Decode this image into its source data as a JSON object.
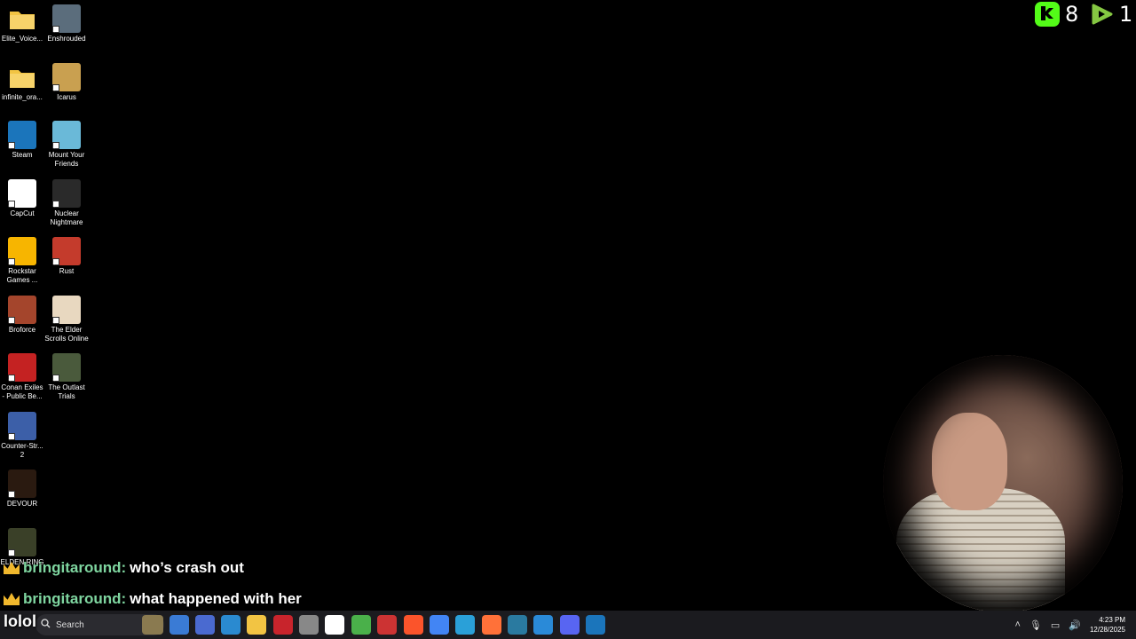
{
  "desktop": {
    "icons": [
      {
        "label": "Elite_Voice...",
        "icon": "folder-icon",
        "color": "#f2c443"
      },
      {
        "label": "Enshrouded",
        "icon": "enshrouded-game-icon",
        "color": "#5b6d7c"
      },
      {
        "label": "infinite_ora...",
        "icon": "folder-icon",
        "color": "#f2c443"
      },
      {
        "label": "Icarus",
        "icon": "icarus-game-icon",
        "color": "#c9a050"
      },
      {
        "label": "Steam",
        "icon": "steam-icon",
        "color": "#1b75bb"
      },
      {
        "label": "Mount Your Friends",
        "icon": "mount-your-friends-icon",
        "color": "#6ab9d8"
      },
      {
        "label": "CapCut",
        "icon": "capcut-icon",
        "color": "#ffffff"
      },
      {
        "label": "Nuclear Nightmare",
        "icon": "nuclear-nightmare-icon",
        "color": "#2a2a2a"
      },
      {
        "label": "Rockstar Games ...",
        "icon": "rockstar-games-icon",
        "color": "#f7b500"
      },
      {
        "label": "Rust",
        "icon": "rust-game-icon",
        "color": "#c43b2c"
      },
      {
        "label": "Broforce",
        "icon": "broforce-icon",
        "color": "#a4452c"
      },
      {
        "label": "The Elder Scrolls Online",
        "icon": "elder-scrolls-online-icon",
        "color": "#e8d8c0"
      },
      {
        "label": "Conan Exiles - Public Be...",
        "icon": "conan-exiles-icon",
        "color": "#c42222"
      },
      {
        "label": "The Outlast Trials",
        "icon": "outlast-trials-icon",
        "color": "#4a5a3c"
      },
      {
        "label": "Counter-Str... 2",
        "icon": "counter-strike-icon",
        "color": "#3c5fa8"
      },
      {
        "label": "DEVOUR",
        "icon": "devour-icon",
        "color": "#2a1a10"
      },
      {
        "label": "ELDEN RING",
        "icon": "elden-ring-icon",
        "color": "#3a4028"
      }
    ]
  },
  "counters": {
    "kick": {
      "value": "8",
      "color": "#53fc18",
      "icon": "kick-icon"
    },
    "rumble": {
      "value": "1",
      "color": "#85c742",
      "icon": "rumble-play-icon"
    }
  },
  "chat": [
    {
      "user": "bringitaround:",
      "message": "who’s crash out"
    },
    {
      "user": "bringitaround:",
      "message": "what happened with her"
    }
  ],
  "taskbar": {
    "overlay_text": "lolol",
    "search_placeholder": "Search",
    "apps": [
      {
        "name": "widget-icon",
        "color": "#8a7a50"
      },
      {
        "name": "app-blue-icon",
        "color": "#3a7bd5"
      },
      {
        "name": "app-screen-icon",
        "color": "#4a6ad0"
      },
      {
        "name": "app-r-icon",
        "color": "#2a8ad0"
      },
      {
        "name": "file-explorer-icon",
        "color": "#f2c443"
      },
      {
        "name": "app-red-icon",
        "color": "#c8242c"
      },
      {
        "name": "app-gauge-icon",
        "color": "#888888"
      },
      {
        "name": "capcut-taskbar-icon",
        "color": "#ffffff"
      },
      {
        "name": "app-green-icon",
        "color": "#4ab04a"
      },
      {
        "name": "app-record-icon",
        "color": "#cc3333"
      },
      {
        "name": "brave-icon",
        "color": "#fb542b"
      },
      {
        "name": "chrome-icon",
        "color": "#4285f4"
      },
      {
        "name": "edge-icon",
        "color": "#2aa0d8"
      },
      {
        "name": "firefox-icon",
        "color": "#ff7139"
      },
      {
        "name": "app-screen2-icon",
        "color": "#2a7aa0"
      },
      {
        "name": "vscode-icon",
        "color": "#2a8ad8"
      },
      {
        "name": "discord-icon",
        "color": "#5865f2"
      },
      {
        "name": "steam-taskbar-icon",
        "color": "#1b75bb"
      }
    ],
    "clock_time": "4:23 PM",
    "clock_date": "12/28/2025"
  }
}
